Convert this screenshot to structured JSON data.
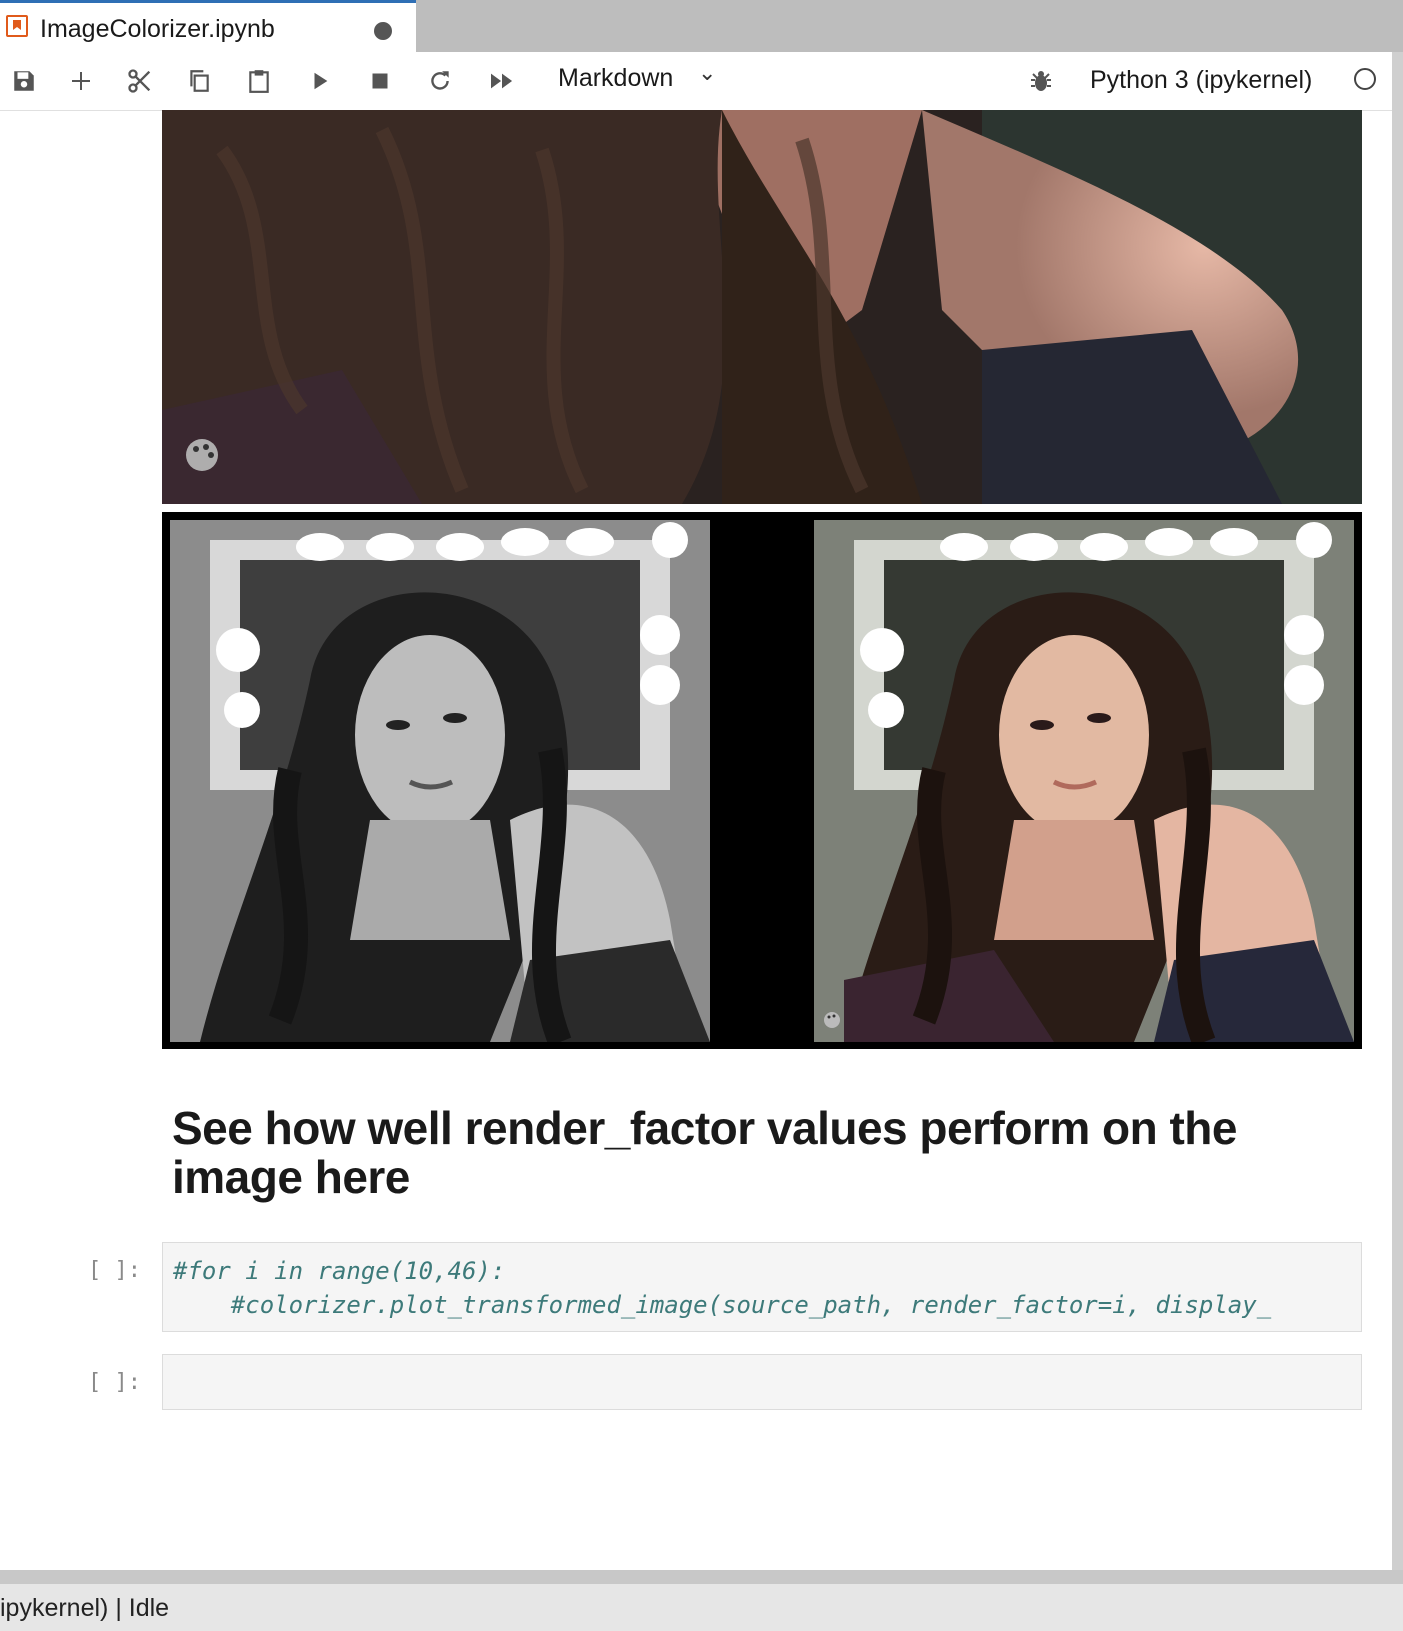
{
  "tab": {
    "title": "ImageColorizer.ipynb",
    "icon": "notebook-icon",
    "unsaved_indicator": "dot"
  },
  "toolbar": {
    "buttons": [
      "save-icon",
      "add-cell-icon",
      "cut-icon",
      "copy-icon",
      "paste-icon",
      "run-icon",
      "stop-icon",
      "restart-icon",
      "run-all-icon"
    ],
    "cell_type": "Markdown",
    "kernel": "Python 3 (ipykernel)"
  },
  "cells": {
    "heading": "See how well render_factor values perform on the image here",
    "code1": {
      "prompt": "[ ]:",
      "line1": "#for i in range(10,46):",
      "line2": "    #colorizer.plot_transformed_image(source_path, render_factor=i, display_"
    },
    "code2": {
      "prompt": "[ ]:"
    }
  },
  "status": {
    "text": "ipykernel) | Idle"
  },
  "colors": {
    "tab_accent": "#2f6fb5",
    "code_comment": "#3d7a7a",
    "notebook_icon": "#e05a1b"
  }
}
